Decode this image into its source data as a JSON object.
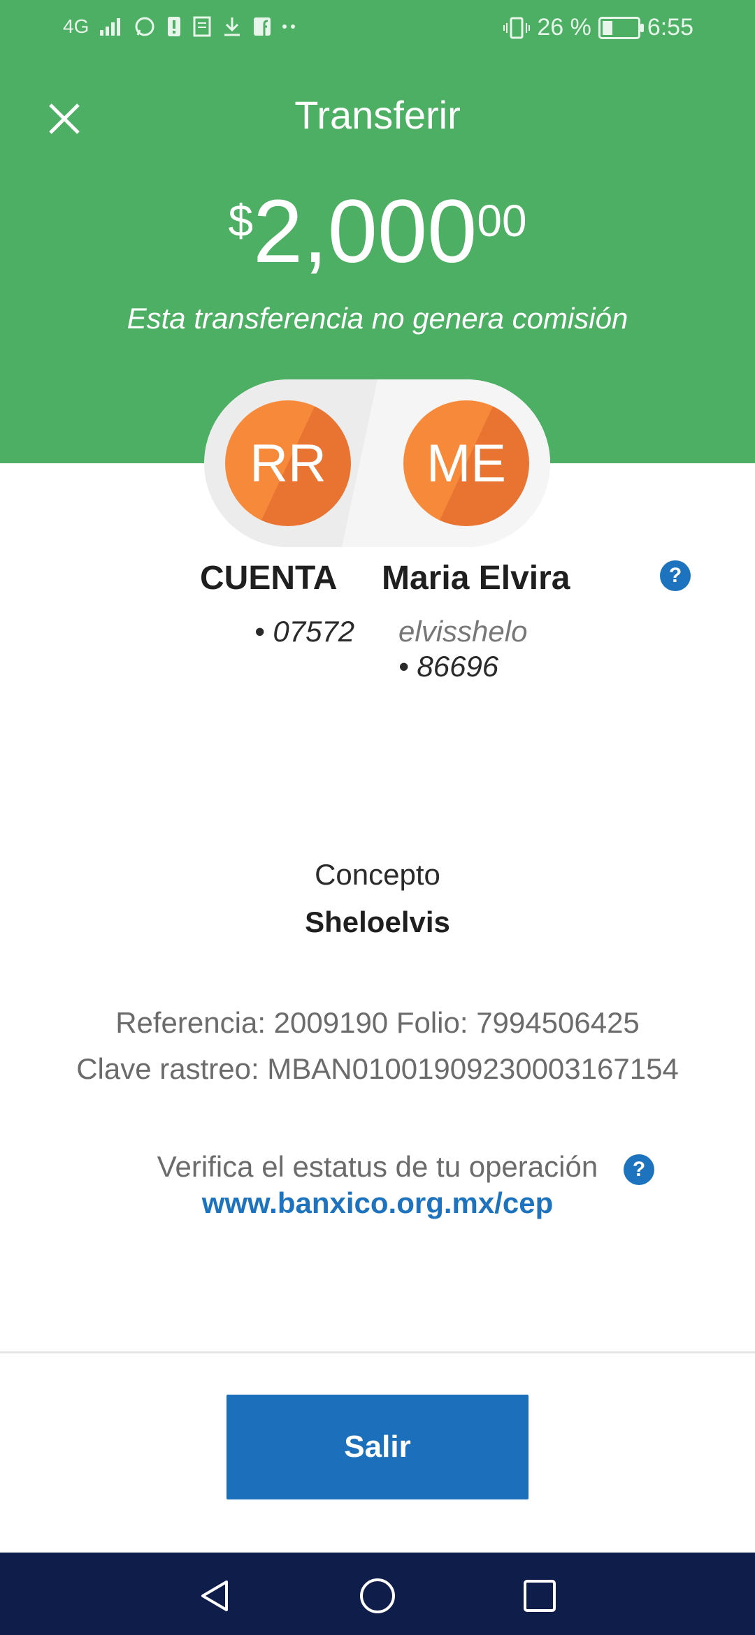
{
  "status_bar": {
    "network": "4G",
    "battery_text": "26 %",
    "battery_level": 0.26,
    "time": "6:55"
  },
  "header": {
    "title": "Transferir",
    "amount_currency": "$",
    "amount_integer": "2,000",
    "amount_decimals": "00",
    "subtitle": "Esta transferencia no genera comisión",
    "background_color": "#4caf63"
  },
  "origin": {
    "initials": "RR",
    "name": "CUENTA",
    "account": "• 07572"
  },
  "destination": {
    "initials": "ME",
    "name": "Maria Elvira",
    "alias": "elvisshelo",
    "account": "• 86696"
  },
  "concept": {
    "label": "Concepto",
    "value": "Sheloelvis"
  },
  "details": {
    "line1": "Referencia: 2009190   Folio: 7994506425",
    "line2": "Clave rastreo: MBAN01001909230003167154"
  },
  "verify": {
    "text": "Verifica el estatus de tu operación",
    "link": "www.banxico.org.mx/cep"
  },
  "help_glyph": "?",
  "actions": {
    "exit_label": "Salir",
    "accent_color": "#1c70bb"
  },
  "icons": {
    "close": "close-icon",
    "help": "help-icon",
    "nav": [
      "back-icon",
      "home-icon",
      "recents-icon"
    ]
  }
}
